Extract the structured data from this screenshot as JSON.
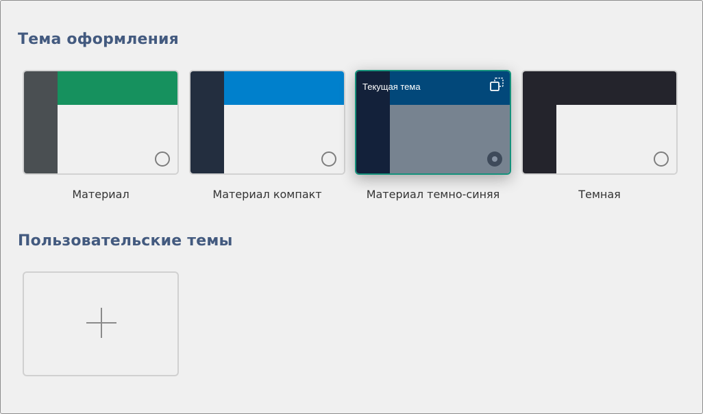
{
  "sections": {
    "themes_title": "Тема оформления",
    "custom_title": "Пользовательские темы"
  },
  "themes": [
    {
      "name": "Материал",
      "colors": {
        "side": "#4a4f52",
        "head": "#16915e",
        "body": "#f0f0f0"
      },
      "selected": false
    },
    {
      "name": "Материал компакт",
      "colors": {
        "side": "#232e3f",
        "head": "#0080cc",
        "body": "#f0f0f0"
      },
      "selected": false
    },
    {
      "name": "Материал темно-синяя",
      "colors": {
        "side": "#13213a",
        "head": "#02487a",
        "body": "#778390"
      },
      "selected": true,
      "current_label": "Текущая тема"
    },
    {
      "name": "Темная",
      "colors": {
        "side": "#24242c",
        "head": "#24242c",
        "body": "#f0f0f0"
      },
      "selected": false
    }
  ],
  "icons": {
    "copy": "copy-icon",
    "add": "plus-icon"
  },
  "accent": {
    "selected_border": "#15917b",
    "title_color": "#435a7f"
  }
}
